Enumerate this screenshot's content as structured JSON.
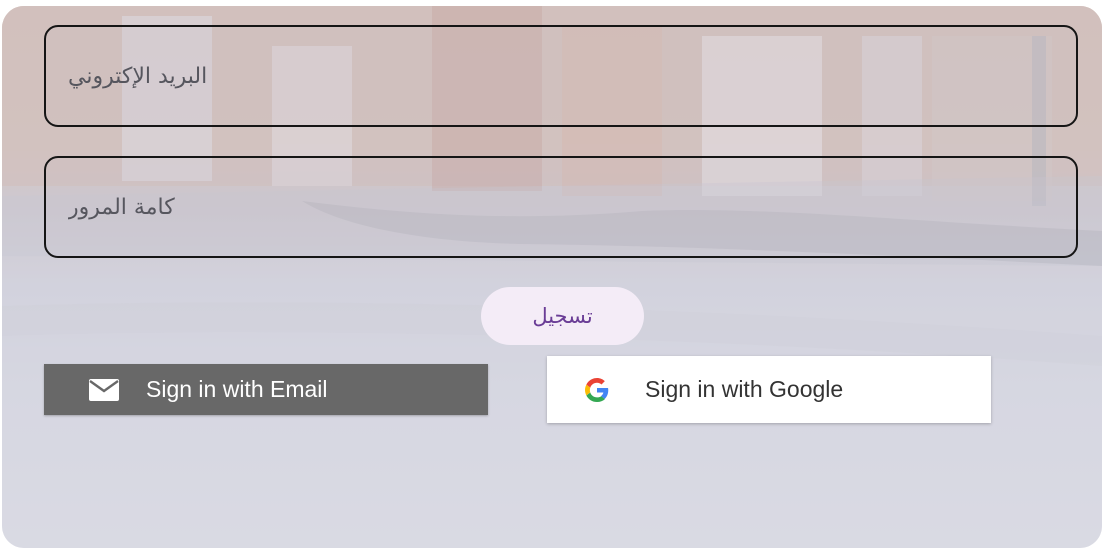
{
  "form": {
    "email_placeholder": "البريد الإكتروني",
    "password_placeholder": "كامة المرور",
    "register_label": "تسجيل"
  },
  "auth": {
    "email_button_label": "Sign in with Email",
    "google_button_label": "Sign in with Google"
  },
  "icons": {
    "email": "mail-icon",
    "google": "google-icon"
  },
  "colors": {
    "field_border": "#151515",
    "register_bg": "#f4ecf7",
    "register_text": "#6a3d96",
    "email_button_bg": "#686868",
    "google_button_bg": "#ffffff"
  }
}
